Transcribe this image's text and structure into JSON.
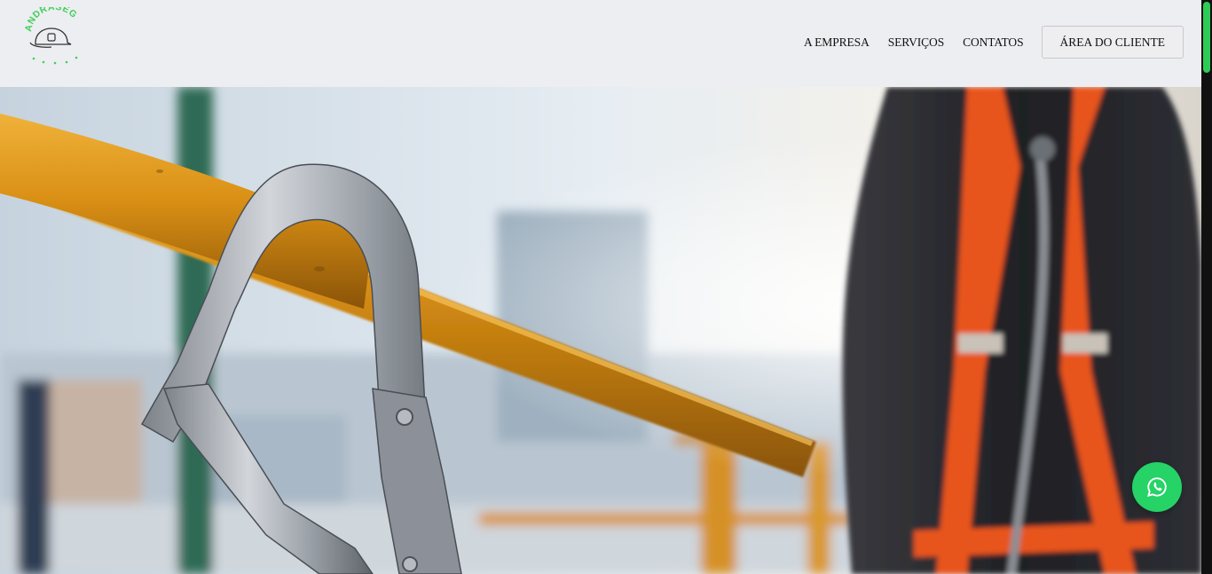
{
  "brand": {
    "logo_text": "ANDRASEG",
    "accent_color": "#3ecf5a"
  },
  "nav": {
    "items": [
      {
        "label": "A EMPRESA"
      },
      {
        "label": "SERVIÇOS"
      },
      {
        "label": "CONTATOS"
      }
    ],
    "client_button": "ÁREA DO CLIENTE"
  },
  "hero": {
    "image_subject": "carabiner-on-railing-with-safety-harness-worker"
  },
  "floating": {
    "whatsapp_icon": "whatsapp-icon",
    "whatsapp_color": "#25d366"
  },
  "scrollbar": {
    "thumb_color": "#2ecc56"
  }
}
